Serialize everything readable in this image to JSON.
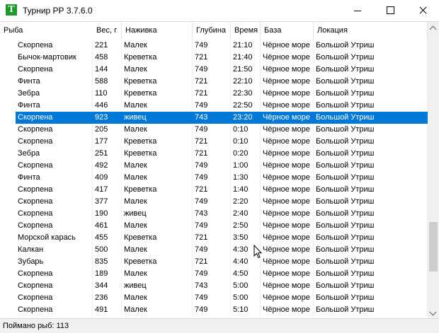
{
  "window": {
    "title": "Турнир РР 3.7.6.0",
    "icon_letter": "T"
  },
  "table": {
    "columns": [
      "Рыба",
      "Вес, г",
      "Наживка",
      "Глубина",
      "Время",
      "База",
      "Локация"
    ],
    "selected_row": 6,
    "rows": [
      [
        "Скорпена",
        "221",
        "Малек",
        "749",
        "21:10",
        "Чёрное море",
        "Большой Утриш"
      ],
      [
        "Бычок-мартовик",
        "458",
        "Креветка",
        "721",
        "21:40",
        "Чёрное море",
        "Большой Утриш"
      ],
      [
        "Скорпена",
        "144",
        "Малек",
        "749",
        "21:50",
        "Чёрное море",
        "Большой Утриш"
      ],
      [
        "Финта",
        "588",
        "Креветка",
        "721",
        "22:10",
        "Чёрное море",
        "Большой Утриш"
      ],
      [
        "Зебра",
        "110",
        "Креветка",
        "721",
        "22:30",
        "Чёрное море",
        "Большой Утриш"
      ],
      [
        "Финта",
        "446",
        "Малек",
        "749",
        "22:50",
        "Чёрное море",
        "Большой Утриш"
      ],
      [
        "Скорпена",
        "923",
        "живец",
        "743",
        "23:20",
        "Чёрное море",
        "Большой Утриш"
      ],
      [
        "Скорпена",
        "205",
        "Малек",
        "749",
        "0:10",
        "Чёрное море",
        "Большой Утриш"
      ],
      [
        "Скорпена",
        "177",
        "Креветка",
        "721",
        "0:10",
        "Чёрное море",
        "Большой Утриш"
      ],
      [
        "Зебра",
        "251",
        "Креветка",
        "721",
        "0:20",
        "Чёрное море",
        "Большой Утриш"
      ],
      [
        "Скорпена",
        "492",
        "Малек",
        "749",
        "1:00",
        "Чёрное море",
        "Большой Утриш"
      ],
      [
        "Финта",
        "409",
        "Малек",
        "749",
        "1:30",
        "Чёрное море",
        "Большой Утриш"
      ],
      [
        "Скорпена",
        "417",
        "Креветка",
        "721",
        "1:40",
        "Чёрное море",
        "Большой Утриш"
      ],
      [
        "Скорпена",
        "377",
        "Малек",
        "749",
        "2:20",
        "Чёрное море",
        "Большой Утриш"
      ],
      [
        "Скорпена",
        "190",
        "живец",
        "743",
        "2:40",
        "Чёрное море",
        "Большой Утриш"
      ],
      [
        "Скорпена",
        "461",
        "Малек",
        "749",
        "2:50",
        "Чёрное море",
        "Большой Утриш"
      ],
      [
        "Морской карась",
        "455",
        "Креветка",
        "721",
        "3:50",
        "Чёрное море",
        "Большой Утриш"
      ],
      [
        "Калкан",
        "500",
        "Малек",
        "749",
        "4:30",
        "Чёрное море",
        "Большой Утриш"
      ],
      [
        "Зубарь",
        "835",
        "Креветка",
        "721",
        "4:40",
        "Чёрное море",
        "Большой Утриш"
      ],
      [
        "Скорпена",
        "189",
        "Малек",
        "749",
        "4:50",
        "Чёрное море",
        "Большой Утриш"
      ],
      [
        "Скорпена",
        "344",
        "живец",
        "743",
        "5:00",
        "Чёрное море",
        "Большой Утриш"
      ],
      [
        "Скорпена",
        "236",
        "Малек",
        "749",
        "5:00",
        "Чёрное море",
        "Большой Утриш"
      ],
      [
        "Скорпена",
        "491",
        "Малек",
        "749",
        "5:10",
        "Чёрное море",
        "Большой Утриш"
      ]
    ]
  },
  "status": {
    "text": "Поймано рыб: 113"
  },
  "colors": {
    "selection": "#0078d7",
    "app_icon": "#1d9a2a"
  }
}
